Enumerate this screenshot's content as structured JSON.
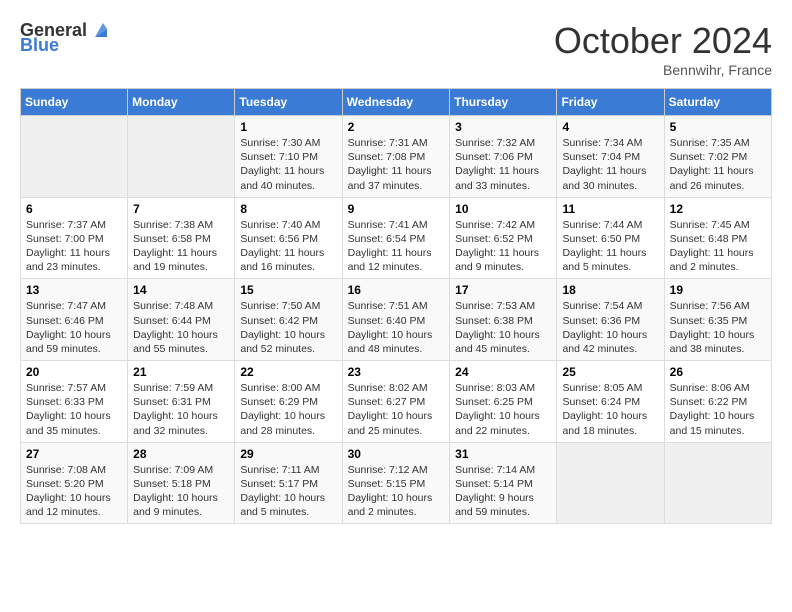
{
  "header": {
    "logo_general": "General",
    "logo_blue": "Blue",
    "month_title": "October 2024",
    "location": "Bennwihr, France"
  },
  "days_of_week": [
    "Sunday",
    "Monday",
    "Tuesday",
    "Wednesday",
    "Thursday",
    "Friday",
    "Saturday"
  ],
  "weeks": [
    [
      {
        "day": "",
        "sunrise": "",
        "sunset": "",
        "daylight": "",
        "empty": true
      },
      {
        "day": "",
        "sunrise": "",
        "sunset": "",
        "daylight": "",
        "empty": true
      },
      {
        "day": "1",
        "sunrise": "Sunrise: 7:30 AM",
        "sunset": "Sunset: 7:10 PM",
        "daylight": "Daylight: 11 hours and 40 minutes."
      },
      {
        "day": "2",
        "sunrise": "Sunrise: 7:31 AM",
        "sunset": "Sunset: 7:08 PM",
        "daylight": "Daylight: 11 hours and 37 minutes."
      },
      {
        "day": "3",
        "sunrise": "Sunrise: 7:32 AM",
        "sunset": "Sunset: 7:06 PM",
        "daylight": "Daylight: 11 hours and 33 minutes."
      },
      {
        "day": "4",
        "sunrise": "Sunrise: 7:34 AM",
        "sunset": "Sunset: 7:04 PM",
        "daylight": "Daylight: 11 hours and 30 minutes."
      },
      {
        "day": "5",
        "sunrise": "Sunrise: 7:35 AM",
        "sunset": "Sunset: 7:02 PM",
        "daylight": "Daylight: 11 hours and 26 minutes."
      }
    ],
    [
      {
        "day": "6",
        "sunrise": "Sunrise: 7:37 AM",
        "sunset": "Sunset: 7:00 PM",
        "daylight": "Daylight: 11 hours and 23 minutes."
      },
      {
        "day": "7",
        "sunrise": "Sunrise: 7:38 AM",
        "sunset": "Sunset: 6:58 PM",
        "daylight": "Daylight: 11 hours and 19 minutes."
      },
      {
        "day": "8",
        "sunrise": "Sunrise: 7:40 AM",
        "sunset": "Sunset: 6:56 PM",
        "daylight": "Daylight: 11 hours and 16 minutes."
      },
      {
        "day": "9",
        "sunrise": "Sunrise: 7:41 AM",
        "sunset": "Sunset: 6:54 PM",
        "daylight": "Daylight: 11 hours and 12 minutes."
      },
      {
        "day": "10",
        "sunrise": "Sunrise: 7:42 AM",
        "sunset": "Sunset: 6:52 PM",
        "daylight": "Daylight: 11 hours and 9 minutes."
      },
      {
        "day": "11",
        "sunrise": "Sunrise: 7:44 AM",
        "sunset": "Sunset: 6:50 PM",
        "daylight": "Daylight: 11 hours and 5 minutes."
      },
      {
        "day": "12",
        "sunrise": "Sunrise: 7:45 AM",
        "sunset": "Sunset: 6:48 PM",
        "daylight": "Daylight: 11 hours and 2 minutes."
      }
    ],
    [
      {
        "day": "13",
        "sunrise": "Sunrise: 7:47 AM",
        "sunset": "Sunset: 6:46 PM",
        "daylight": "Daylight: 10 hours and 59 minutes."
      },
      {
        "day": "14",
        "sunrise": "Sunrise: 7:48 AM",
        "sunset": "Sunset: 6:44 PM",
        "daylight": "Daylight: 10 hours and 55 minutes."
      },
      {
        "day": "15",
        "sunrise": "Sunrise: 7:50 AM",
        "sunset": "Sunset: 6:42 PM",
        "daylight": "Daylight: 10 hours and 52 minutes."
      },
      {
        "day": "16",
        "sunrise": "Sunrise: 7:51 AM",
        "sunset": "Sunset: 6:40 PM",
        "daylight": "Daylight: 10 hours and 48 minutes."
      },
      {
        "day": "17",
        "sunrise": "Sunrise: 7:53 AM",
        "sunset": "Sunset: 6:38 PM",
        "daylight": "Daylight: 10 hours and 45 minutes."
      },
      {
        "day": "18",
        "sunrise": "Sunrise: 7:54 AM",
        "sunset": "Sunset: 6:36 PM",
        "daylight": "Daylight: 10 hours and 42 minutes."
      },
      {
        "day": "19",
        "sunrise": "Sunrise: 7:56 AM",
        "sunset": "Sunset: 6:35 PM",
        "daylight": "Daylight: 10 hours and 38 minutes."
      }
    ],
    [
      {
        "day": "20",
        "sunrise": "Sunrise: 7:57 AM",
        "sunset": "Sunset: 6:33 PM",
        "daylight": "Daylight: 10 hours and 35 minutes."
      },
      {
        "day": "21",
        "sunrise": "Sunrise: 7:59 AM",
        "sunset": "Sunset: 6:31 PM",
        "daylight": "Daylight: 10 hours and 32 minutes."
      },
      {
        "day": "22",
        "sunrise": "Sunrise: 8:00 AM",
        "sunset": "Sunset: 6:29 PM",
        "daylight": "Daylight: 10 hours and 28 minutes."
      },
      {
        "day": "23",
        "sunrise": "Sunrise: 8:02 AM",
        "sunset": "Sunset: 6:27 PM",
        "daylight": "Daylight: 10 hours and 25 minutes."
      },
      {
        "day": "24",
        "sunrise": "Sunrise: 8:03 AM",
        "sunset": "Sunset: 6:25 PM",
        "daylight": "Daylight: 10 hours and 22 minutes."
      },
      {
        "day": "25",
        "sunrise": "Sunrise: 8:05 AM",
        "sunset": "Sunset: 6:24 PM",
        "daylight": "Daylight: 10 hours and 18 minutes."
      },
      {
        "day": "26",
        "sunrise": "Sunrise: 8:06 AM",
        "sunset": "Sunset: 6:22 PM",
        "daylight": "Daylight: 10 hours and 15 minutes."
      }
    ],
    [
      {
        "day": "27",
        "sunrise": "Sunrise: 7:08 AM",
        "sunset": "Sunset: 5:20 PM",
        "daylight": "Daylight: 10 hours and 12 minutes."
      },
      {
        "day": "28",
        "sunrise": "Sunrise: 7:09 AM",
        "sunset": "Sunset: 5:18 PM",
        "daylight": "Daylight: 10 hours and 9 minutes."
      },
      {
        "day": "29",
        "sunrise": "Sunrise: 7:11 AM",
        "sunset": "Sunset: 5:17 PM",
        "daylight": "Daylight: 10 hours and 5 minutes."
      },
      {
        "day": "30",
        "sunrise": "Sunrise: 7:12 AM",
        "sunset": "Sunset: 5:15 PM",
        "daylight": "Daylight: 10 hours and 2 minutes."
      },
      {
        "day": "31",
        "sunrise": "Sunrise: 7:14 AM",
        "sunset": "Sunset: 5:14 PM",
        "daylight": "Daylight: 9 hours and 59 minutes."
      },
      {
        "day": "",
        "sunrise": "",
        "sunset": "",
        "daylight": "",
        "empty": true
      },
      {
        "day": "",
        "sunrise": "",
        "sunset": "",
        "daylight": "",
        "empty": true
      }
    ]
  ]
}
